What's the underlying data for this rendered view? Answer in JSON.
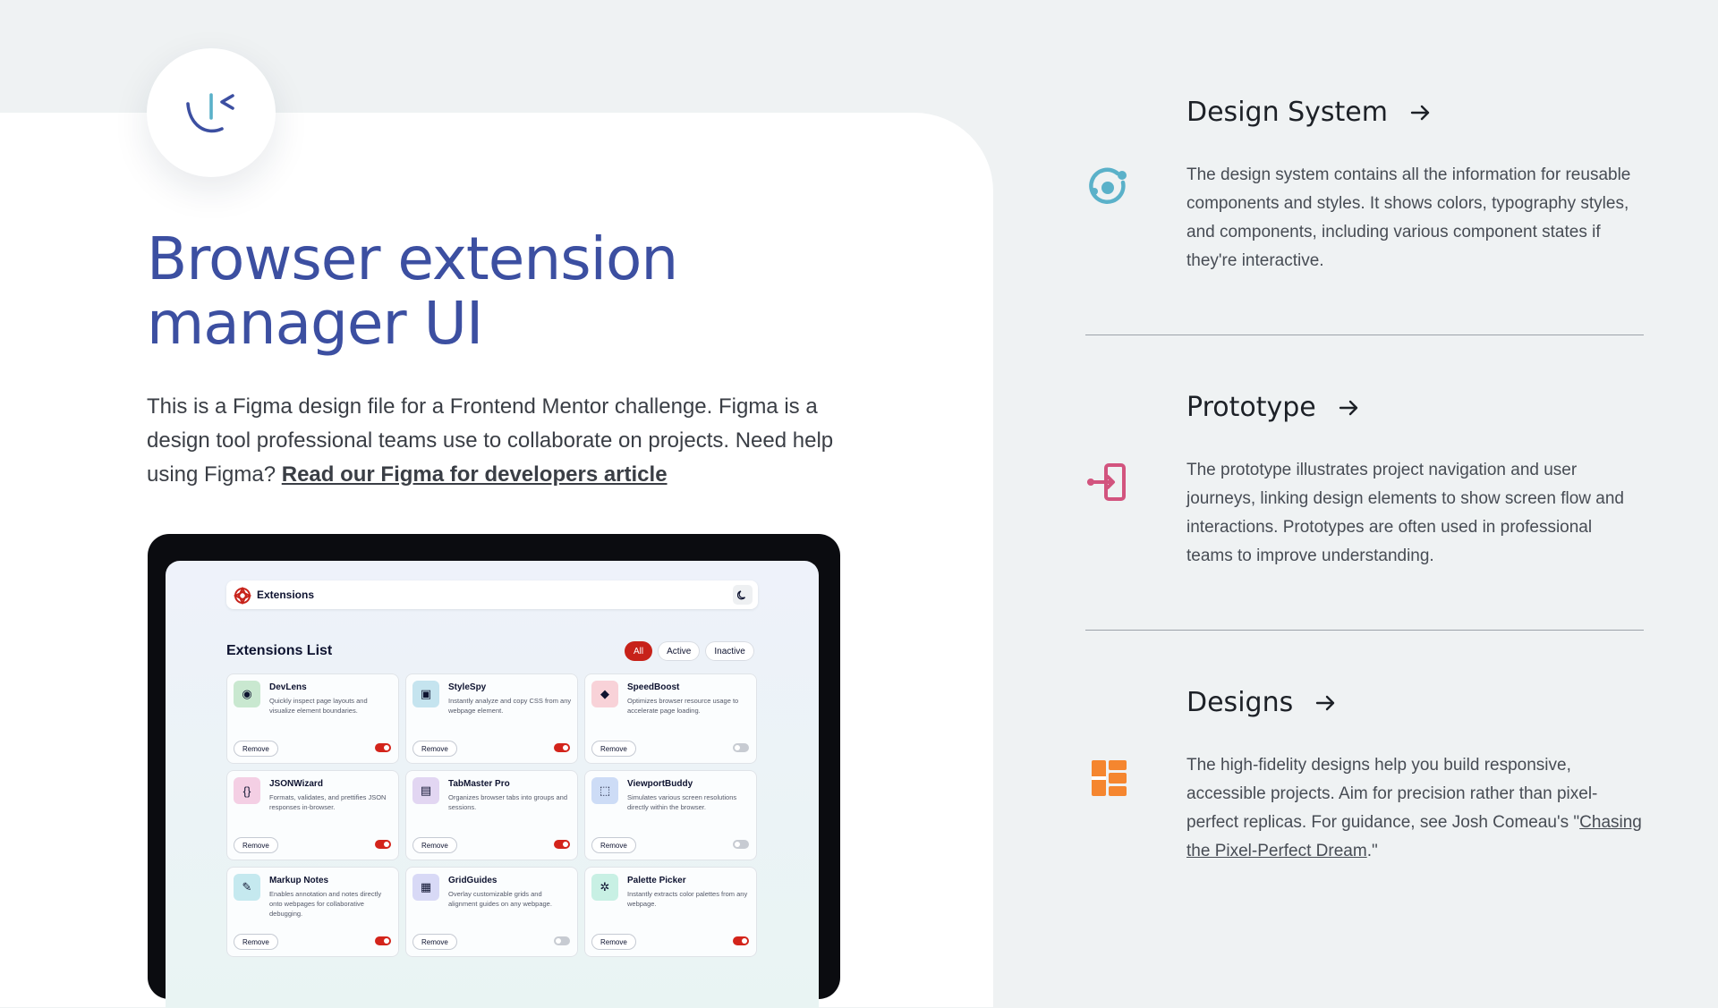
{
  "hero": {
    "title": "Browser extension manager UI",
    "intro_text": "This is a Figma design file for a Frontend Mentor challenge. Figma is a design tool professional teams use to collaborate on projects. Need help using Figma? ",
    "intro_link": "Read our Figma for developers article"
  },
  "preview": {
    "brand": "Extensions",
    "list_title": "Extensions List",
    "filters": [
      "All",
      "Active",
      "Inactive"
    ],
    "active_filter": "All",
    "remove_label": "Remove",
    "extensions": [
      {
        "name": "DevLens",
        "description": "Quickly inspect page layouts and visualize element boundaries.",
        "enabled": true,
        "icon": "devlens-icon",
        "color": "#c9e8d0"
      },
      {
        "name": "StyleSpy",
        "description": "Instantly analyze and copy CSS from any webpage element.",
        "enabled": true,
        "icon": "stylespy-icon",
        "color": "#c5e4ef"
      },
      {
        "name": "SpeedBoost",
        "description": "Optimizes browser resource usage to accelerate page loading.",
        "enabled": false,
        "icon": "speedboost-icon",
        "color": "#f8d2d8"
      },
      {
        "name": "JSONWizard",
        "description": "Formats, validates, and prettifies JSON responses in-browser.",
        "enabled": true,
        "icon": "jsonwizard-icon",
        "color": "#f4cfe4"
      },
      {
        "name": "TabMaster Pro",
        "description": "Organizes browser tabs into groups and sessions.",
        "enabled": true,
        "icon": "tabmaster-icon",
        "color": "#e2d6f2"
      },
      {
        "name": "ViewportBuddy",
        "description": "Simulates various screen resolutions directly within the browser.",
        "enabled": false,
        "icon": "viewportbuddy-icon",
        "color": "#cddcf6"
      },
      {
        "name": "Markup Notes",
        "description": "Enables annotation and notes directly onto webpages for collaborative debugging.",
        "enabled": true,
        "icon": "markup-notes-icon",
        "color": "#c5e9ef"
      },
      {
        "name": "GridGuides",
        "description": "Overlay customizable grids and alignment guides on any webpage.",
        "enabled": false,
        "icon": "gridguides-icon",
        "color": "#d8d9f6"
      },
      {
        "name": "Palette Picker",
        "description": "Instantly extracts color palettes from any webpage.",
        "enabled": true,
        "icon": "palette-picker-icon",
        "color": "#c8f0e4"
      }
    ]
  },
  "sections": [
    {
      "title": "Design System",
      "description": "The design system contains all the information for reusable components  and styles. It shows colors, typography styles, and components,  including various component states if they're interactive.",
      "icon": "design-system-icon",
      "color": "#5ab1c9"
    },
    {
      "title": "Prototype",
      "description": "The prototype illustrates project navigation and user journeys,  linking design elements to show screen flow and interactions. Prototypes  are often used in professional teams to improve understanding.",
      "icon": "prototype-icon",
      "color": "#d2547e"
    },
    {
      "title": "Designs",
      "description_before": "The high-fidelity designs help you build responsive, accessible  projects. Aim for precision rather than pixel-perfect replicas. For  guidance, see Josh Comeau's \"",
      "link": "Chasing the Pixel-Perfect Dream",
      "description_after": ".\"",
      "icon": "designs-icon",
      "color": "#f5862f"
    }
  ],
  "colors": {
    "accent": "#3c4fa1",
    "toggle_on": "#d3241b",
    "background": "#eff2f3"
  }
}
